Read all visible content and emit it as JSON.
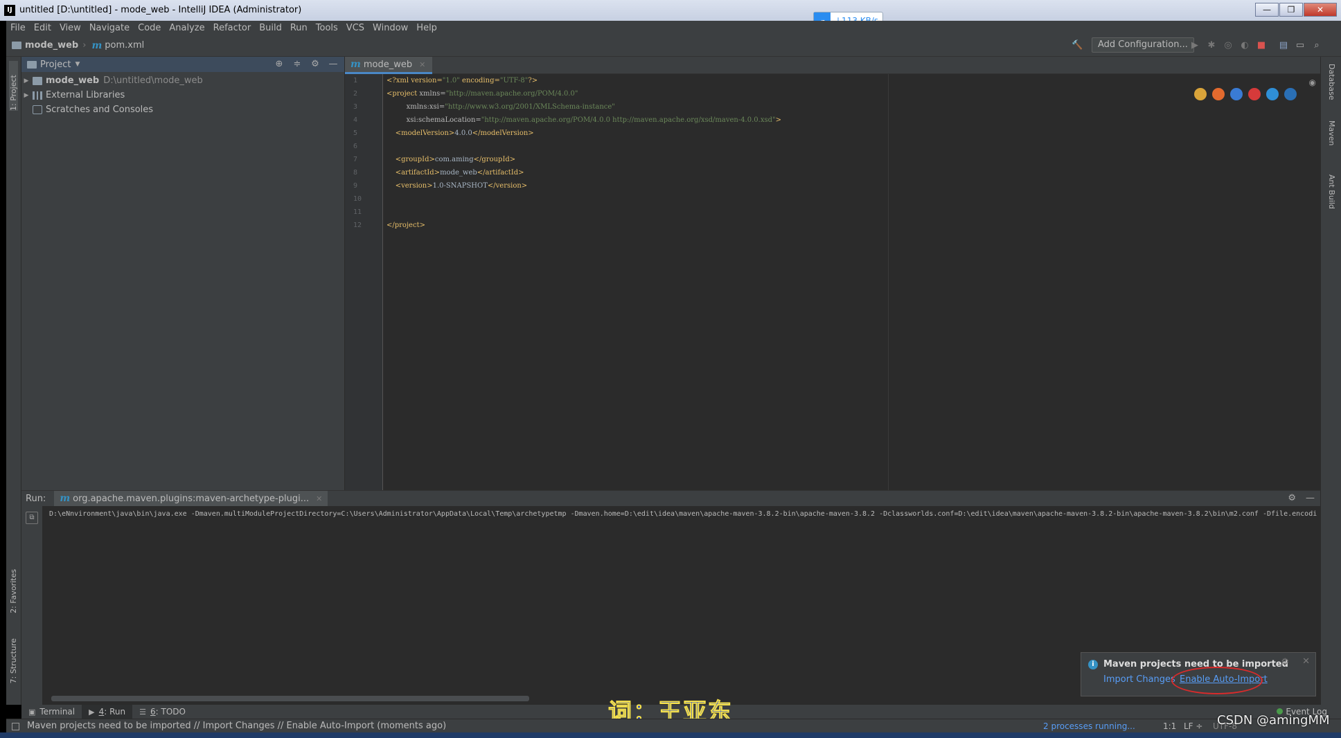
{
  "window": {
    "title": "untitled [D:\\untitled] - mode_web - IntelliJ IDEA (Administrator)",
    "app_icon": "IJ",
    "buttons": [
      "—",
      "❐",
      "✕"
    ]
  },
  "speed_widget": {
    "text": "↓113 KB/s",
    "icon": "cloud-icon"
  },
  "menu": [
    "File",
    "Edit",
    "View",
    "Navigate",
    "Code",
    "Analyze",
    "Refactor",
    "Build",
    "Run",
    "Tools",
    "VCS",
    "Window",
    "Help"
  ],
  "navbar": {
    "crumbs": [
      "mode_web",
      "pom.xml"
    ],
    "add_configuration": "Add Configuration..."
  },
  "left_strip": {
    "project_label": "1: Project",
    "favorites_label": "2: Favorites",
    "structure_label": "7: Structure"
  },
  "right_strip": {
    "database": "Database",
    "maven": "Maven",
    "ant": "Ant Build"
  },
  "project_panel": {
    "header": "Project",
    "tree": [
      {
        "name": "mode_web",
        "path": "D:\\untitled\\mode_web"
      },
      {
        "name": "External Libraries"
      },
      {
        "name": "Scratches and Consoles"
      }
    ]
  },
  "editor": {
    "tab": "mode_web",
    "line_numbers": [
      "1",
      "2",
      "3",
      "4",
      "5",
      "6",
      "7",
      "8",
      "9",
      "10",
      "11",
      "12"
    ],
    "lines": {
      "l1a": "<?xml version=",
      "l1b": "\"1.0\"",
      "l1c": " encoding=",
      "l1d": "\"UTF-8\"",
      "l1e": "?>",
      "l2a": "<project ",
      "l2b": "xmlns=",
      "l2c": "\"http://maven.apache.org/POM/4.0.0\"",
      "l3a": "         xmlns:xsi=",
      "l3b": "\"http://www.w3.org/2001/XMLSchema-instance\"",
      "l4a": "         xsi:schemaLocation=",
      "l4b": "\"http://maven.apache.org/POM/4.0.0 http://maven.apache.org/xsd/maven-4.0.0.xsd\"",
      "l4c": ">",
      "l5a": "    <modelVersion>",
      "l5b": "4.0.0",
      "l5c": "</modelVersion>",
      "l7a": "    <groupId>",
      "l7b": "com.aming",
      "l7c": "</groupId>",
      "l8a": "    <artifactId>",
      "l8b": "mode_web",
      "l8c": "</artifactId>",
      "l9a": "    <version>",
      "l9b": "1.0-SNAPSHOT",
      "l9c": "</version>",
      "l12": "</project>"
    }
  },
  "run_panel": {
    "label": "Run:",
    "tab": "org.apache.maven.plugins:maven-archetype-plugi...",
    "output": "D:\\eNnvironment\\java\\bin\\java.exe -Dmaven.multiModuleProjectDirectory=C:\\Users\\Administrator\\AppData\\Local\\Temp\\archetypetmp -Dmaven.home=D:\\edit\\idea\\maven\\apache-maven-3.8.2-bin\\apache-maven-3.8.2 -Dclassworlds.conf=D:\\edit\\idea\\maven\\apache-maven-3.8.2-bin\\apache-maven-3.8.2\\bin\\m2.conf -Dfile.encoding"
  },
  "notification": {
    "title": "Maven projects need to be imported",
    "import_changes": "Import Changes",
    "enable_auto_import": "Enable Auto-Import"
  },
  "bottom_tabs": {
    "terminal": "Terminal",
    "run_num": "4",
    "run_text": ": Run",
    "todo_num": "6",
    "todo_text": ": TODO",
    "event_log": "Event Log"
  },
  "status": {
    "message": "Maven projects need to be imported // Import Changes // Enable Auto-Import (moments ago)",
    "processes": "2 processes running...",
    "position": "1:1",
    "line_sep": "LF ÷",
    "encoding": "UTF-8"
  },
  "overlay": {
    "subtitle": "词：王亚东",
    "watermark": "CSDN @amingMM"
  },
  "colors": {
    "accent": "#4a88c7",
    "link": "#589df6",
    "tag": "#e8bf6a",
    "string": "#6a8759",
    "circle": "#d92b2b"
  }
}
